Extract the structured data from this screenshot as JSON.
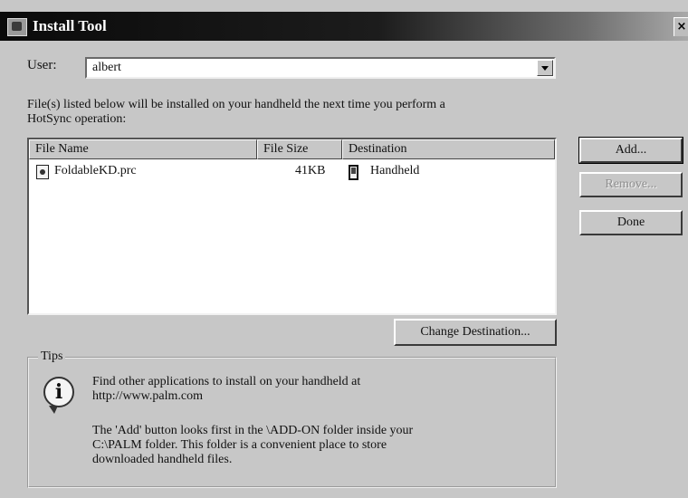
{
  "window": {
    "title": "Install Tool",
    "close_label": "×"
  },
  "user": {
    "label": "User:",
    "value": "albert"
  },
  "description": "File(s) listed below will be installed on your handheld the next time you perform a HotSync operation:",
  "table": {
    "columns": [
      "File Name",
      "File Size",
      "Destination"
    ],
    "rows": [
      {
        "file_name": "FoldableKD.prc",
        "file_size": "41KB",
        "destination": "Handheld"
      }
    ]
  },
  "buttons": {
    "add": "Add...",
    "remove": "Remove...",
    "done": "Done",
    "change_destination": "Change Destination..."
  },
  "tips": {
    "legend": "Tips",
    "line1": "Find other applications to install on your handheld at",
    "line2": "http://www.palm.com",
    "line3": "The 'Add' button looks first in the \\ADD-ON folder inside your",
    "line4": "C:\\PALM folder. This folder is a convenient place to store",
    "line5": "downloaded handheld files."
  },
  "icons": {
    "window": "install-tool-icon",
    "file": "prc-file-icon",
    "destination": "handheld-icon",
    "tips": "info-icon"
  }
}
